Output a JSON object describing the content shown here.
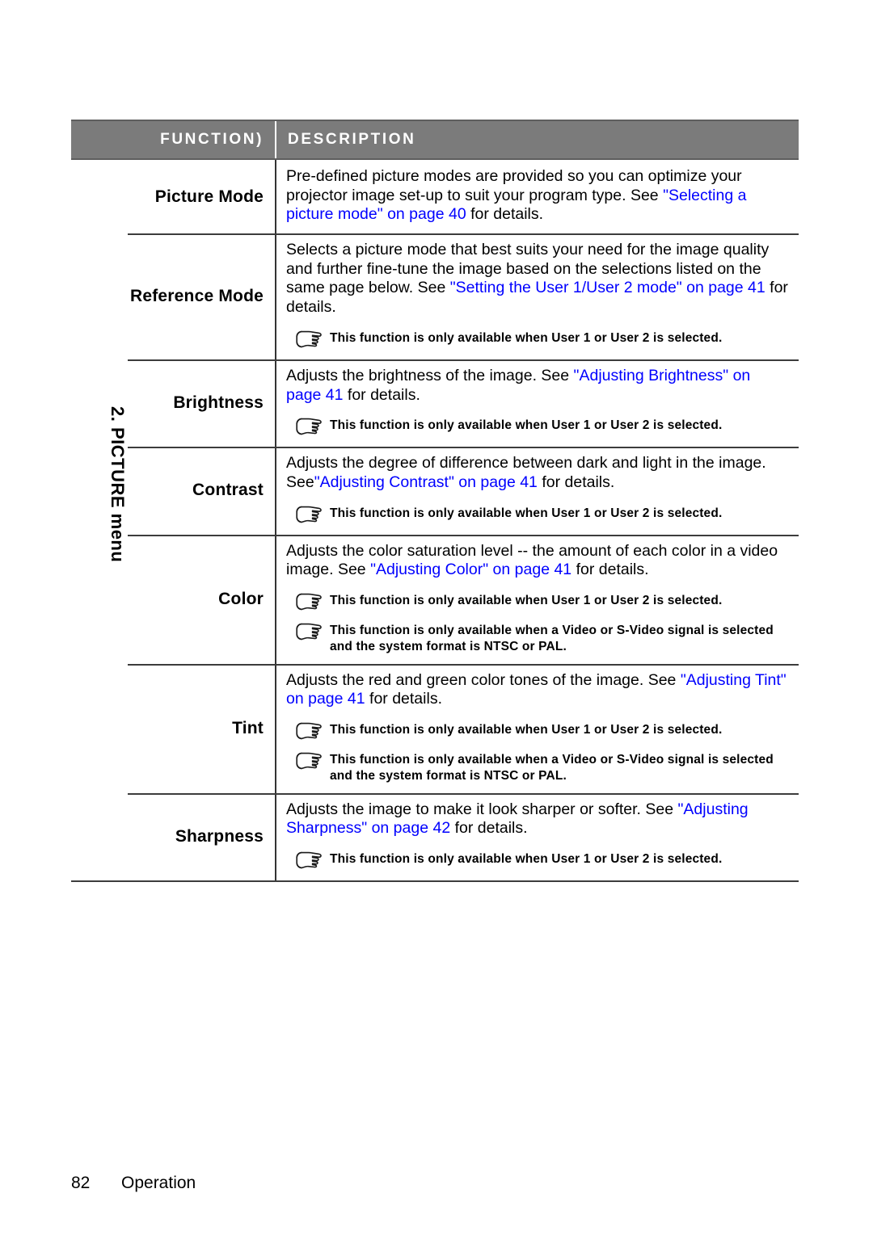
{
  "page": {
    "number": "82",
    "section": "Operation",
    "menu_label": "2. PICTURE menu"
  },
  "colors": {
    "header_bg": "#7b7b7b",
    "header_text": "#ffffff",
    "link": "#0000ff",
    "rule": "#3c3c3c",
    "body_text": "#000000"
  },
  "table": {
    "headers": {
      "function": "FUNCTION)",
      "description": "DESCRIPTION"
    },
    "rows": [
      {
        "function": "Picture Mode",
        "description": {
          "pre": "Pre-defined picture modes are provided so you can optimize your projector image set-up to suit your program type. See ",
          "link": "\"Selecting a picture mode\" on page 40",
          "post": " for details."
        },
        "notes": []
      },
      {
        "function": "Reference Mode",
        "description": {
          "pre": "Selects a picture mode that best suits your need for the image quality and further fine-tune the image based on the selections listed on the same page below. See ",
          "link": "\"Setting the User 1/User 2 mode\" on page 41",
          "post": " for details."
        },
        "notes": [
          "This function is only available when User 1 or User 2 is selected."
        ]
      },
      {
        "function": "Brightness",
        "description": {
          "pre": "Adjusts the brightness of the image. See ",
          "link": "\"Adjusting Brightness\" on page 41",
          "post": " for details."
        },
        "notes": [
          "This function is only available when User 1 or User 2 is selected."
        ]
      },
      {
        "function": "Contrast",
        "description": {
          "pre": "Adjusts the degree of difference between dark and light in the image. See",
          "link": "\"Adjusting Contrast\" on page 41",
          "post": " for details."
        },
        "notes": [
          "This function is only available when User 1 or User 2 is selected."
        ]
      },
      {
        "function": "Color",
        "description": {
          "pre": "Adjusts the color saturation level -- the amount of each color in a video image. See ",
          "link": "\"Adjusting Color\" on page 41",
          "post": " for details."
        },
        "notes": [
          "This function is only available when User 1 or User 2 is selected.",
          "This function is only available when a Video or S-Video signal is selected and the system format is NTSC or PAL."
        ]
      },
      {
        "function": "Tint",
        "description": {
          "pre": "Adjusts the red and green color tones of the image. See ",
          "link": "\"Adjusting Tint\" on page 41",
          "post": " for details."
        },
        "notes": [
          "This function is only available when User 1 or User 2 is selected.",
          "This function is only available when a Video or S-Video signal is selected and the system format is NTSC or PAL."
        ]
      },
      {
        "function": "Sharpness",
        "description": {
          "pre": "Adjusts the image to make it look sharper or softer. See ",
          "link": "\"Adjusting Sharpness\" on page 42",
          "post": " for details."
        },
        "notes": [
          "This function is only available when User 1 or User 2 is selected."
        ]
      }
    ]
  },
  "icons": {
    "note": "pointing-hand-icon"
  }
}
